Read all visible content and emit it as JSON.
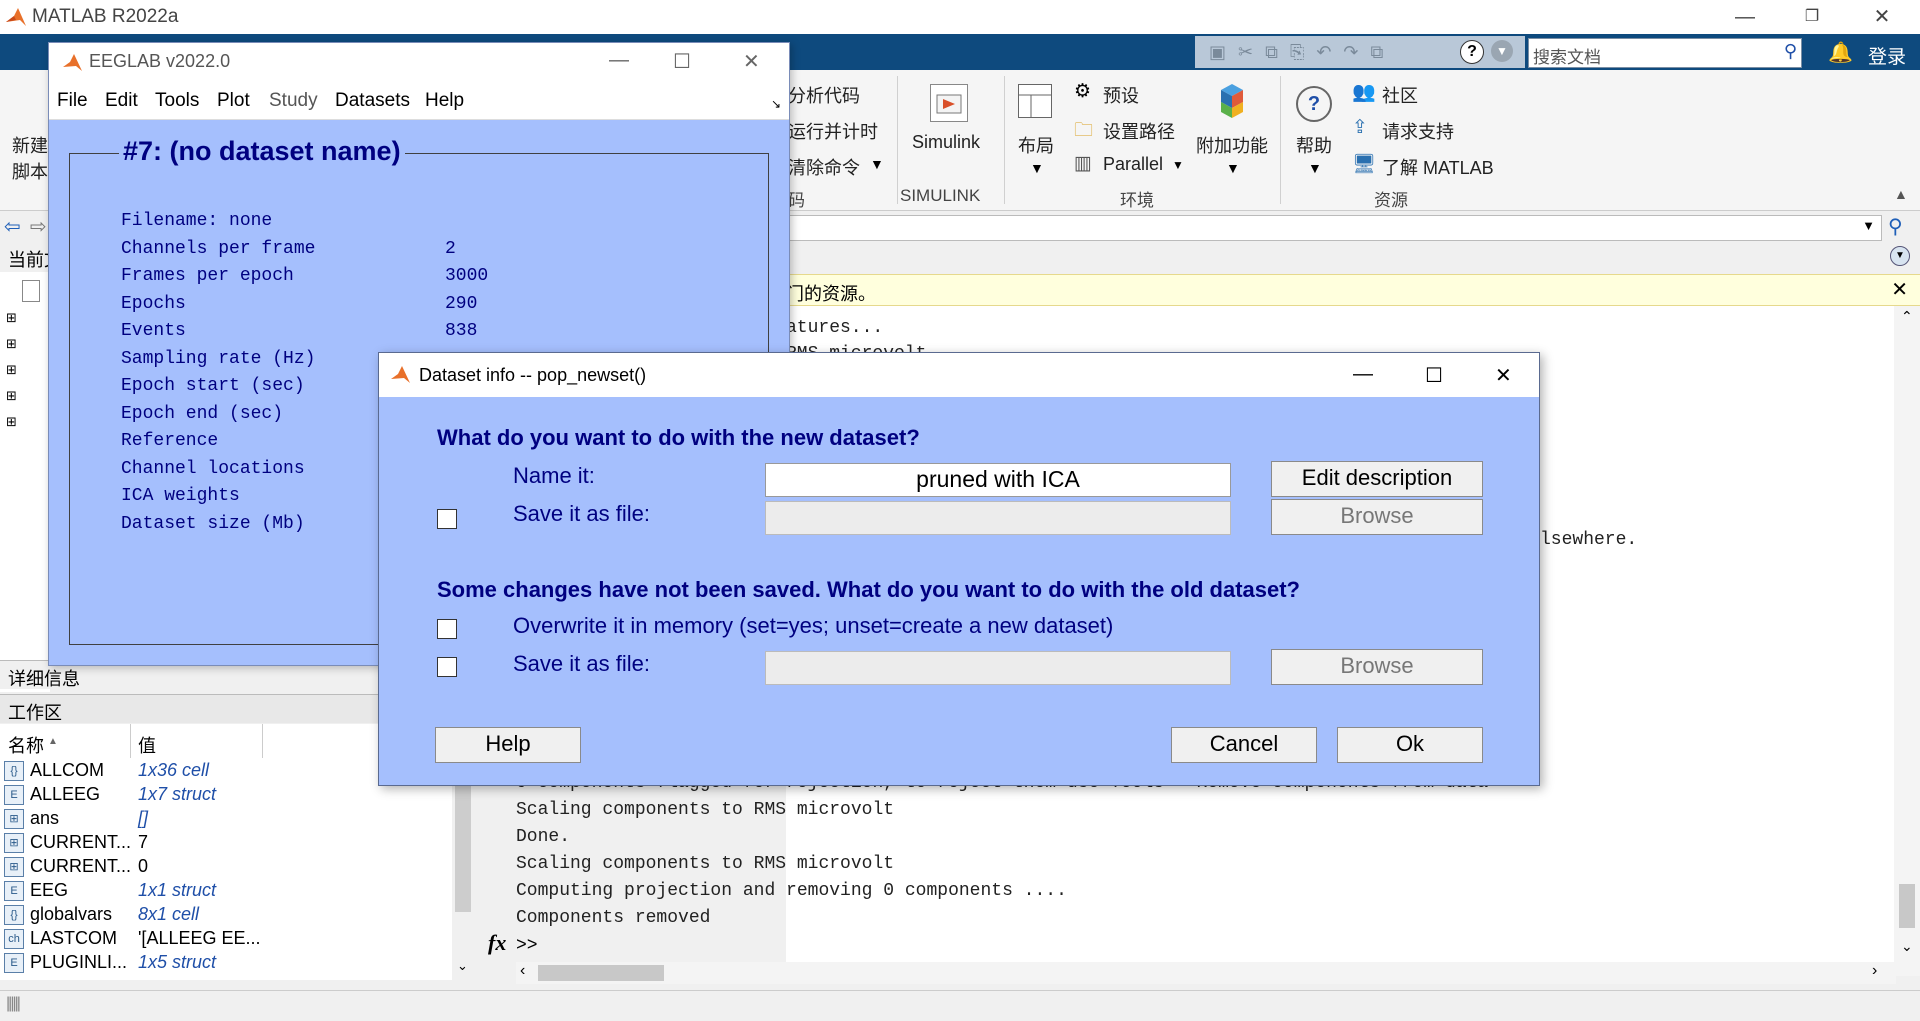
{
  "matlab": {
    "title": "MATLAB R2022a",
    "search_placeholder": "搜索文档",
    "login": "登录",
    "ribbon": {
      "new_script": [
        "新建",
        "脚本"
      ],
      "code_items": [
        "分析代码",
        "运行并计时",
        "清除命令"
      ],
      "code_label": "码",
      "simulink": "Simulink",
      "simulink_label": "SIMULINK",
      "layout": "布局",
      "prefs": "预设",
      "set_path": "设置路径",
      "parallel": "Parallel",
      "addons": "附加功能",
      "env_label": "环境",
      "help": "帮助",
      "community": "社区",
      "support": "请求支持",
      "learn": "了解 MATLAB",
      "resources_label": "资源"
    },
    "current_folder": "当前文",
    "notice_text": "门的资源。",
    "details_label": "详细信息",
    "workspace_label": "工作区",
    "ws_col_name": "名称",
    "ws_col_value": "值",
    "workspace": [
      {
        "icon": "{}",
        "name": "ALLCOM",
        "value": "1x36 cell",
        "italic": true
      },
      {
        "icon": "E",
        "name": "ALLEEG",
        "value": "1x7 struct",
        "italic": true
      },
      {
        "icon": "⊞",
        "name": "ans",
        "value": "[]",
        "italic": true
      },
      {
        "icon": "⊞",
        "name": "CURRENT...",
        "value": "7",
        "italic": false
      },
      {
        "icon": "⊞",
        "name": "CURRENT...",
        "value": "0",
        "italic": false
      },
      {
        "icon": "E",
        "name": "EEG",
        "value": "1x1 struct",
        "italic": true
      },
      {
        "icon": "{}",
        "name": "globalvars",
        "value": "8x1 cell",
        "italic": true
      },
      {
        "icon": "ch",
        "name": "LASTCOM",
        "value": "'[ALLEEG EE...",
        "italic": false
      },
      {
        "icon": "E",
        "name": "PLUGINLI...",
        "value": "1x5 struct",
        "italic": true
      }
    ],
    "cmd_fragments": [
      "atures...",
      "RMS microvolt",
      "lsewhere."
    ],
    "cmd_lines": [
      "0 components flagged for rejection, to reject them use Tools > Remove components from data",
      "Scaling components to RMS microvolt",
      "Done.",
      "Scaling components to RMS microvolt",
      "Computing projection and removing 0 components ....",
      "Components removed"
    ],
    "prompt": ">>"
  },
  "eeglab": {
    "title": "EEGLAB v2022.0",
    "menu": [
      "File",
      "Edit",
      "Tools",
      "Plot",
      "Study",
      "Datasets",
      "Help"
    ],
    "heading": "#7: (no dataset name)",
    "fields": [
      {
        "label": "Filename: none",
        "value": ""
      },
      {
        "label": "Channels per frame",
        "value": "2"
      },
      {
        "label": "Frames per epoch",
        "value": "3000"
      },
      {
        "label": "Epochs",
        "value": "290"
      },
      {
        "label": "Events",
        "value": "838"
      },
      {
        "label": "Sampling rate (Hz)",
        "value": ""
      },
      {
        "label": "Epoch start (sec)",
        "value": ""
      },
      {
        "label": "Epoch end (sec)",
        "value": ""
      },
      {
        "label": "Reference",
        "value": ""
      },
      {
        "label": "Channel locations",
        "value": ""
      },
      {
        "label": "ICA weights",
        "value": ""
      },
      {
        "label": "Dataset size (Mb)",
        "value": ""
      }
    ]
  },
  "dialog": {
    "title": "Dataset info -- pop_newset()",
    "q_new": "What do you want to do with the new dataset?",
    "name_label": "Name it:",
    "name_value": "pruned with ICA",
    "edit_desc": "Edit description",
    "save_label_1": "Save it as file:",
    "browse": "Browse",
    "q_old": "Some changes have not been saved. What do you want to do with the old dataset?",
    "overwrite_label": "Overwrite it in memory (set=yes; unset=create a new dataset)",
    "save_label_2": "Save it as file:",
    "help": "Help",
    "cancel": "Cancel",
    "ok": "Ok"
  }
}
